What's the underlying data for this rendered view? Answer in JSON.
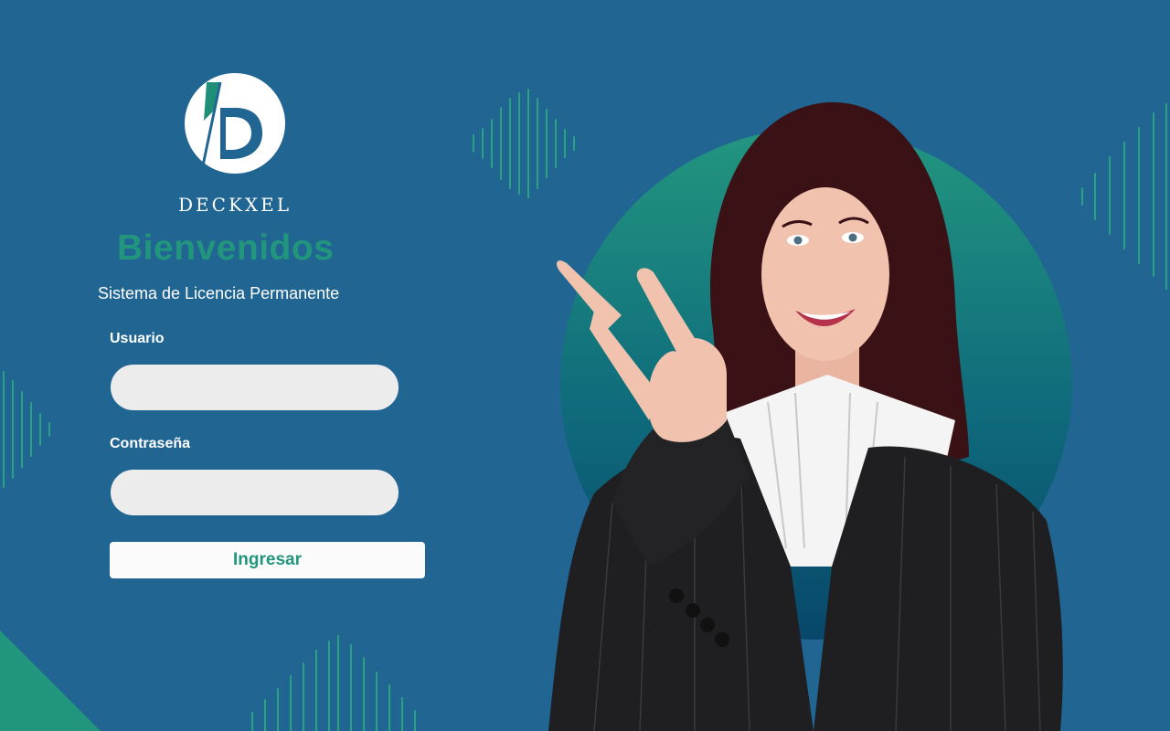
{
  "brand": {
    "name": "DECKXEL"
  },
  "login": {
    "title": "Bienvenidos",
    "subtitle": "Sistema de Licencia Permanente",
    "username_label": "Usuario",
    "username_value": "",
    "password_label": "Contraseña",
    "password_value": "",
    "submit_label": "Ingresar"
  },
  "theme": {
    "background": "#216593",
    "accent": "#21967d",
    "field_fill": "#ececec",
    "button_fill": "#fbfbfb"
  }
}
